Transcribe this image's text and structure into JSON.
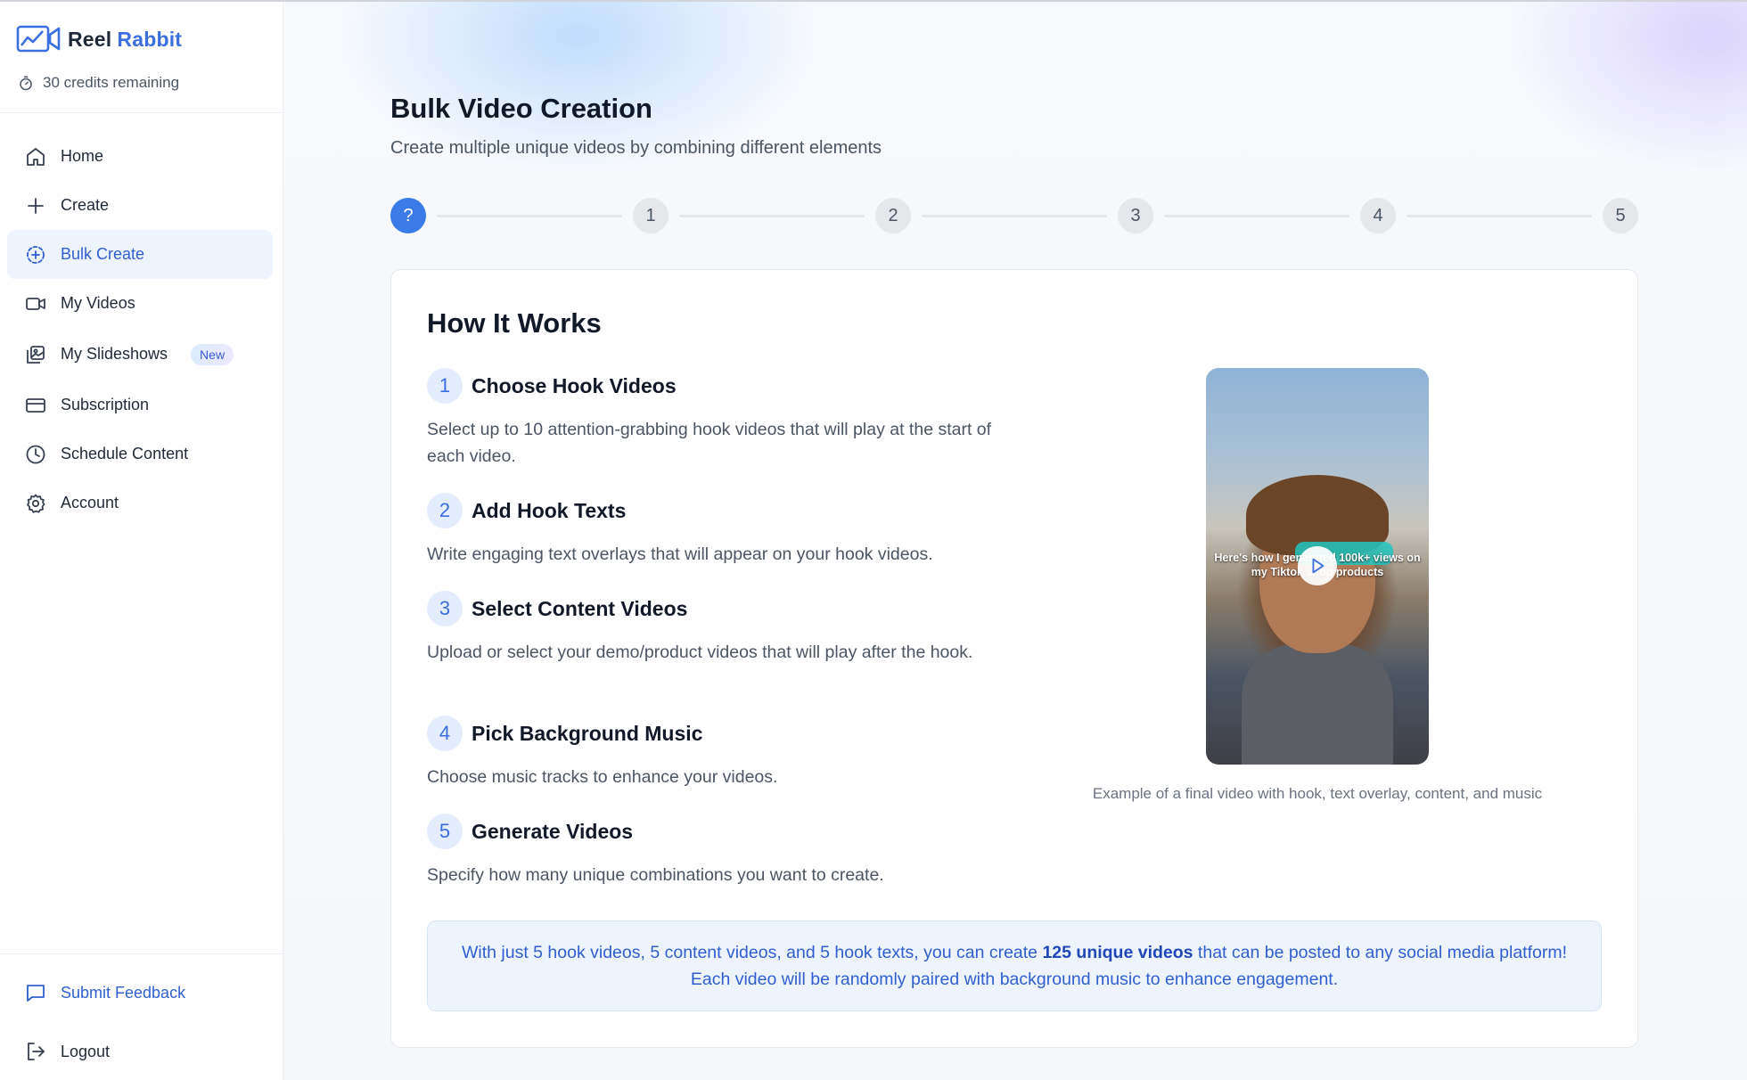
{
  "brand": {
    "name_part1": "Reel",
    "name_part2": "Rabbit"
  },
  "credits": {
    "text": "30 credits remaining"
  },
  "nav": {
    "items": [
      {
        "label": "Home"
      },
      {
        "label": "Create"
      },
      {
        "label": "Bulk Create"
      },
      {
        "label": "My Videos"
      },
      {
        "label": "My Slideshows",
        "badge": "New"
      },
      {
        "label": "Subscription"
      },
      {
        "label": "Schedule Content"
      },
      {
        "label": "Account"
      }
    ],
    "active": "Bulk Create"
  },
  "footer": {
    "feedback": "Submit Feedback",
    "logout": "Logout"
  },
  "page": {
    "title": "Bulk Video Creation",
    "subtitle": "Create multiple unique videos by combining different elements"
  },
  "stepper": {
    "steps": [
      "?",
      "1",
      "2",
      "3",
      "4",
      "5"
    ],
    "current_index": 0
  },
  "how_it_works": {
    "title": "How It Works",
    "steps": [
      {
        "num": "1",
        "title": "Choose Hook Videos",
        "desc": "Select up to 10 attention-grabbing hook videos that will play at the start of each video."
      },
      {
        "num": "2",
        "title": "Add Hook Texts",
        "desc": "Write engaging text overlays that will appear on your hook videos."
      },
      {
        "num": "3",
        "title": "Select Content Videos",
        "desc": "Upload or select your demo/product videos that will play after the hook."
      },
      {
        "num": "4",
        "title": "Pick Background Music",
        "desc": "Choose music tracks to enhance your videos."
      },
      {
        "num": "5",
        "title": "Generate Videos",
        "desc": "Specify how many unique combinations you want to create."
      }
    ],
    "video_overlay_text": "Here's how I generated 100k+ views on my Tiktok shop products",
    "video_caption": "Example of a final video with hook, text overlay, content, and music"
  },
  "info": {
    "before": "With just 5 hook videos, 5 content videos, and 5 hook texts, you can create ",
    "highlight": "125 unique videos",
    "after": " that can be posted to any social media platform! Each video will be randomly paired with background music to enhance engagement."
  },
  "colors": {
    "accent": "#3b7be8",
    "active_bg": "#eef4fe",
    "info_bg": "#eef4fd",
    "info_text": "#2f5fd0"
  }
}
